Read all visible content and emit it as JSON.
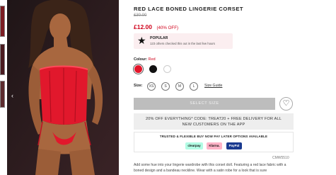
{
  "product": {
    "title": "RED LACE BONED LINGERIE CORSET",
    "old_price": "£30.00",
    "price": "£12.00",
    "discount": "(40% OFF)"
  },
  "popular": {
    "title": "POPULAR",
    "subtitle": "123 others checked this out in the last few hours",
    "icon": "star-icon"
  },
  "colour": {
    "label": "Colour:",
    "value": "Red",
    "swatches": [
      "#e3152a",
      "#111111",
      "#ffffff"
    ]
  },
  "size": {
    "label": "Size:",
    "options": [
      "XS",
      "S",
      "M",
      "L"
    ],
    "guide": "Size Guide"
  },
  "cta": {
    "select_size": "SELECT SIZE",
    "wishlist_icon": "heart-icon"
  },
  "promo": {
    "line1": "20% OFF EVERYTHING* CODE: TREAT20 + FREE DELIVERY FOR ALL",
    "line2": "NEW CUSTOMERS ON THE APP"
  },
  "bnpl": {
    "title": "TRUSTED & FLEXIBLE BUY NOW PAY LATER OPTIONS AVAILABLE",
    "providers": [
      "clearpay",
      "Klarna.",
      "PayPal"
    ]
  },
  "sku": "CMW5510",
  "description": "Add some hue into your lingerie wardrobe with this corset doll. Featuring a red lace fabric with a boned design and a bandeau neckline. Wear with a satin robe for a look that is sure",
  "colors": {
    "accent": "#d0021b",
    "popular_bg": "#fbeef0",
    "button_disabled": "#bdbdbd"
  }
}
